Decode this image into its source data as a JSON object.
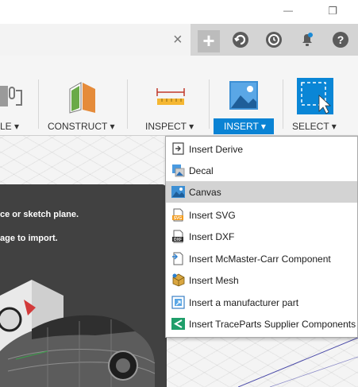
{
  "window": {
    "minimize_label": "—",
    "restore_label": "❐"
  },
  "tabbar": {
    "close_label": "×",
    "new_tab_label": "+"
  },
  "toolbar": {
    "groups": [
      {
        "label": "LE ▾"
      },
      {
        "label": "CONSTRUCT ▾"
      },
      {
        "label": "INSPECT ▾"
      },
      {
        "label": "INSERT ▾"
      },
      {
        "label": "SELECT ▾"
      }
    ],
    "active_group": "INSERT",
    "active_color": "#0a83d4"
  },
  "tooltip": {
    "line1": "ce or sketch plane.",
    "line2": "age to import."
  },
  "insert_menu": {
    "items": [
      {
        "label": "Insert Derive",
        "icon": "derive-icon"
      },
      {
        "label": "Decal",
        "icon": "decal-icon"
      },
      {
        "label": "Canvas",
        "icon": "canvas-icon",
        "highlighted": true
      },
      {
        "label": "Insert SVG",
        "icon": "svg-file-icon"
      },
      {
        "label": "Insert DXF",
        "icon": "dxf-file-icon"
      },
      {
        "label": "Insert McMaster-Carr Component",
        "icon": "mcmaster-icon"
      },
      {
        "label": "Insert Mesh",
        "icon": "mesh-icon"
      },
      {
        "label": "Insert a manufacturer part",
        "icon": "manufacturer-part-icon"
      },
      {
        "label": "Insert TraceParts Supplier Components",
        "icon": "traceparts-icon"
      }
    ]
  }
}
